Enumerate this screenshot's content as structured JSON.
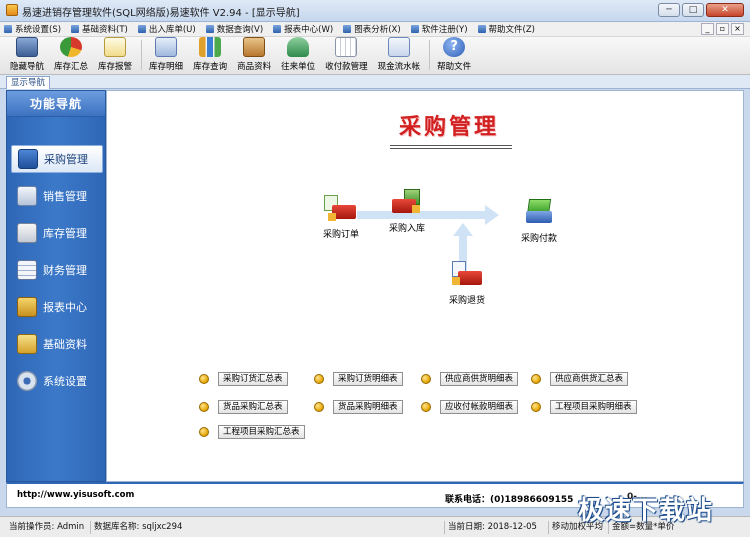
{
  "window": {
    "title": "易速进销存管理软件(SQL网络版)易速软件 V2.94 - [显示导航]",
    "controls": [
      "─",
      "□",
      "✕"
    ]
  },
  "menu": {
    "items": [
      {
        "label": "系统设置(S)"
      },
      {
        "label": "基础资料(T)"
      },
      {
        "label": "出入库单(U)"
      },
      {
        "label": "数据查询(V)"
      },
      {
        "label": "报表中心(W)"
      },
      {
        "label": "图表分析(X)"
      },
      {
        "label": "软件注册(Y)"
      },
      {
        "label": "帮助文件(Z)"
      }
    ],
    "mdi_controls": [
      "_",
      "▫",
      "×"
    ]
  },
  "toolbar": {
    "buttons": [
      {
        "label": "隐藏导航",
        "icon": "monitor-icon",
        "color": "#5b7fb3"
      },
      {
        "label": "库存汇总",
        "icon": "pie-chart-icon",
        "color": "#3a9a3a"
      },
      {
        "label": "库存报警",
        "icon": "alert-document-icon",
        "color": "#d8a72a"
      },
      {
        "label": "库存明细",
        "icon": "chart-document-icon",
        "color": "#6f8fc2"
      },
      {
        "label": "库存查询",
        "icon": "bar-chart-icon",
        "color": "#e0a02c"
      },
      {
        "label": "商品资料",
        "icon": "product-box-icon",
        "color": "#c98a35"
      },
      {
        "label": "往来单位",
        "icon": "contacts-icon",
        "color": "#3f9a5b"
      },
      {
        "label": "收付款管理",
        "icon": "calendar-icon",
        "color": "#9aa6b8"
      },
      {
        "label": "现金流水帐",
        "icon": "cash-search-icon",
        "color": "#5b83c2"
      },
      {
        "label": "帮助文件",
        "icon": "help-icon",
        "color": "#3b6fc5"
      }
    ]
  },
  "tab": {
    "label": "显示导航"
  },
  "sidenav": {
    "header": "功能导航",
    "items": [
      {
        "label": "采购管理",
        "icon": "purchase-icon",
        "active": true
      },
      {
        "label": "销售管理",
        "icon": "sales-cart-icon",
        "active": false
      },
      {
        "label": "库存管理",
        "icon": "inventory-cart-icon",
        "active": false
      },
      {
        "label": "财务管理",
        "icon": "finance-table-icon",
        "active": false
      },
      {
        "label": "报表中心",
        "icon": "report-truck-icon",
        "active": false
      },
      {
        "label": "基础资料",
        "icon": "basic-data-icon",
        "active": false
      },
      {
        "label": "系统设置",
        "icon": "settings-gear-icon",
        "active": false
      }
    ]
  },
  "main": {
    "title": "采购管理",
    "flow": [
      {
        "label": "采购订单",
        "icon": "purchase-order-truck-icon"
      },
      {
        "label": "采购入库",
        "icon": "purchase-storage-truck-icon"
      },
      {
        "label": "采购付款",
        "icon": "purchase-payment-icon"
      },
      {
        "label": "采购退货",
        "icon": "purchase-return-truck-icon"
      }
    ],
    "reports": [
      {
        "label": "采购订货汇总表"
      },
      {
        "label": "采购订货明细表"
      },
      {
        "label": "供应商供货明细表"
      },
      {
        "label": "供应商供货汇总表"
      },
      {
        "label": "货品采购汇总表"
      },
      {
        "label": "货品采购明细表"
      },
      {
        "label": "应收付帐款明细表"
      },
      {
        "label": "工程项目采购明细表"
      },
      {
        "label": "工程项目采购汇总表"
      }
    ]
  },
  "footer": {
    "url": "http://www.yisusoft.com",
    "tel": "联系电话：(0)18986609155",
    "tel2": "0-..."
  },
  "statusbar": {
    "operator": "当前操作员: Admin",
    "database": "数据库名称: sqljxc294",
    "date": "当前日期: 2018-12-05",
    "method": "移动加权平均",
    "formula": "金额=数量*单价"
  },
  "watermark": "极速下载站",
  "colors": {
    "accent": "#2f67b6",
    "title_red": "#d22020"
  }
}
